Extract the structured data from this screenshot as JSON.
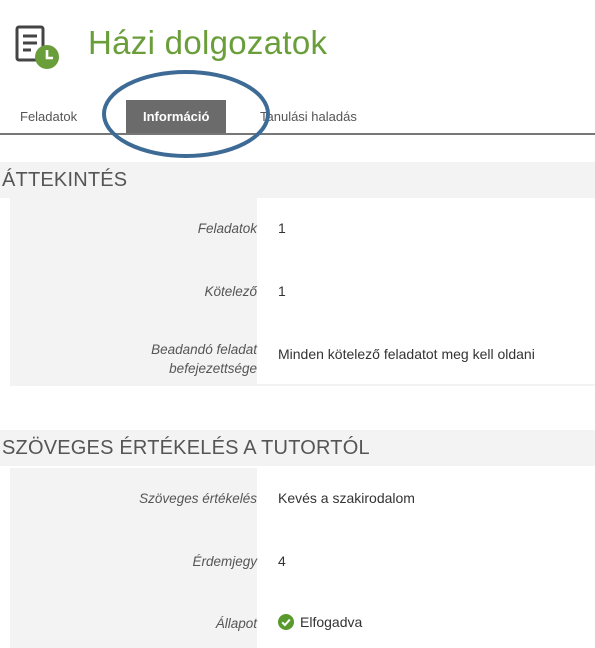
{
  "header": {
    "title": "Házi dolgozatok",
    "icon": "assignment-clock-icon",
    "accent_color": "#6a9e3a"
  },
  "tabs": [
    {
      "label": "Feladatok",
      "active": false
    },
    {
      "label": "Információ",
      "active": true
    },
    {
      "label": "Tanulási haladás",
      "active": false
    }
  ],
  "overview": {
    "title": "ÁTTEKINTÉS",
    "rows": [
      {
        "label": "Feladatok",
        "value": "1"
      },
      {
        "label": "Kötelező",
        "value": "1"
      },
      {
        "label_line1": "Beadandó feladat",
        "label_line2": "befejezettsége",
        "value": "Minden kötelező feladatot meg kell oldani"
      }
    ]
  },
  "feedback": {
    "title": "SZÖVEGES ÉRTÉKELÉS A TUTORTÓL",
    "rows": [
      {
        "label": "Szöveges értékelés",
        "value": "Kevés a szakirodalom"
      },
      {
        "label": "Érdemjegy",
        "value": "4"
      },
      {
        "label": "Állapot",
        "value": "Elfogadva",
        "icon": "check-circle-icon",
        "icon_color": "#5a9a2c"
      }
    ]
  },
  "annotation": {
    "shape": "ellipse",
    "color": "#3d6b95",
    "target": "Információ tab"
  }
}
